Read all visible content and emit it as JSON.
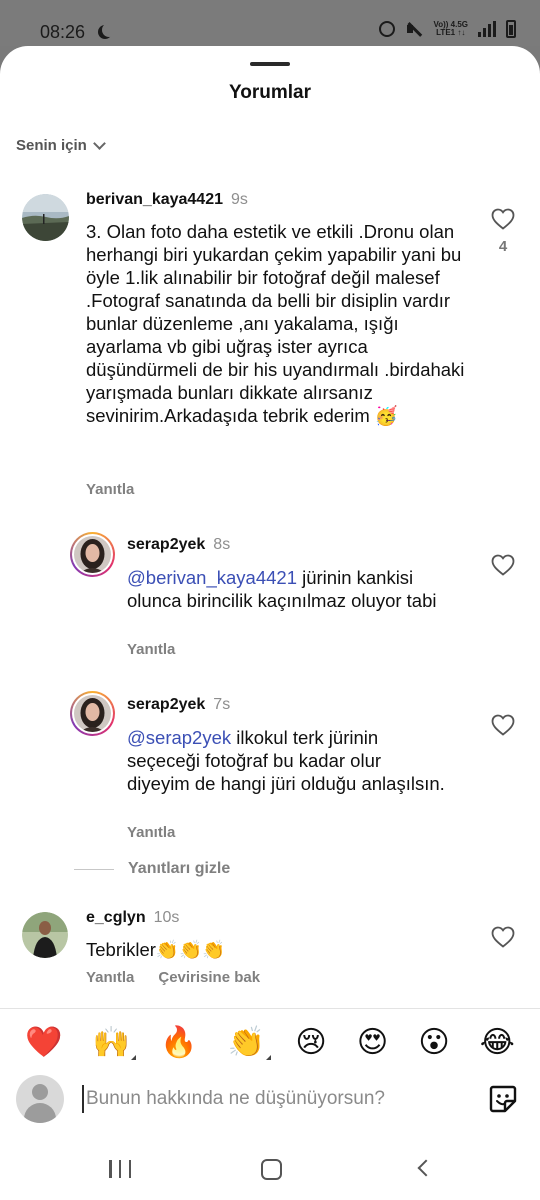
{
  "status_bar": {
    "time": "08:26",
    "volte": "Vo)) 4.5G",
    "lte": "LTE1 ↑↓"
  },
  "sheet": {
    "title": "Yorumlar",
    "filter_label": "Senin için"
  },
  "comments": [
    {
      "username": "berivan_kaya4421",
      "time": "9s",
      "text": "3. Olan foto  daha estetik ve etkili .Dronu olan herhangi biri yukardan çekim yapabilir yani bu öyle 1.lik alınabilir bir fotoğraf değil malesef .Fotograf sanatında da belli bir disiplin vardır bunlar düzenleme ,anı yakalama, ışığı ayarlama vb gibi uğraş ister ayrıca düşündürmeli de bir his uyandırmalı .birdahaki yarışmada bunları dikkate alırsanız sevinirim.Arkadaşıda tebrik ederim 🥳",
      "reply_label": "Yanıtla",
      "like_count": "4"
    },
    {
      "username": "serap2yek",
      "time": "8s",
      "mention": "@berivan_kaya4421",
      "text": " jürinin kankisi olunca birincilik kaçınılmaz oluyor tabi",
      "reply_label": "Yanıtla"
    },
    {
      "username": "serap2yek",
      "time": "7s",
      "mention": "@serap2yek",
      "text": " ilkokul terk jürinin seçeceği fotoğraf bu kadar olur diyeyim de hangi jüri olduğu anlaşılsın.",
      "reply_label": "Yanıtla"
    },
    {
      "username": "e_cglyn",
      "time": "10s",
      "text": "Tebrikler👏👏👏",
      "reply_label": "Yanıtla",
      "translate_label": "Çevirisine bak"
    }
  ],
  "hide_replies_label": "Yanıtları gizle",
  "emoji_bar": [
    "❤️",
    "🙌",
    "🔥",
    "👏",
    "😢",
    "😍",
    "😮",
    "😂"
  ],
  "compose": {
    "placeholder": "Bunun hakkında ne düşünüyorsun?"
  },
  "colors": {
    "mention": "#3b4fb5",
    "muted": "#808080",
    "heart": "#e0245e"
  }
}
